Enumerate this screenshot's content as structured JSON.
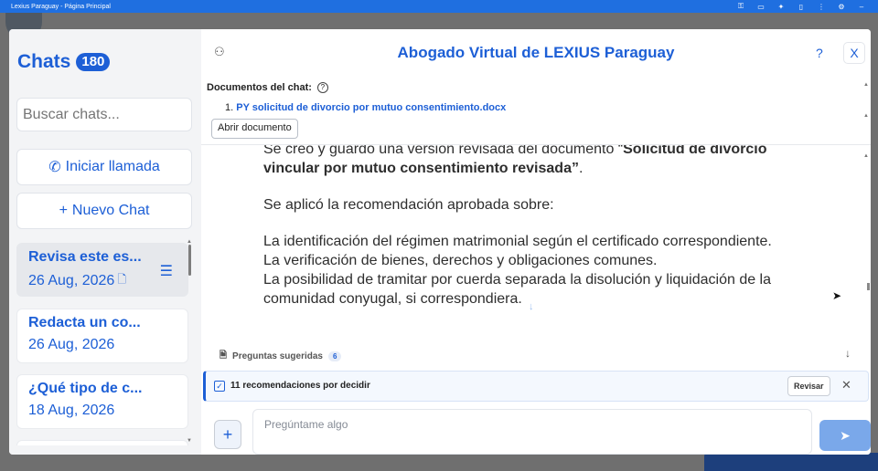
{
  "window": {
    "title": "Lexius Paraguay - Página Principal",
    "icons": [
      "key-icon",
      "tab-icon",
      "extension-icon",
      "panel-icon",
      "more-icon",
      "settings-icon",
      "minimize-icon"
    ]
  },
  "left": {
    "title": "Chats",
    "count": "180",
    "search_placeholder": "Buscar chats...",
    "call_label": "Iniciar llamada",
    "new_chat_label": "Nuevo Chat",
    "chats": [
      {
        "title": "Revisa este es...",
        "date": "26 Aug, 2026"
      },
      {
        "title": "Redacta un co...",
        "date": "26 Aug, 2026"
      },
      {
        "title": "¿Qué tipo de c...",
        "date": "18 Aug, 2026"
      }
    ]
  },
  "right": {
    "title": "Abogado Virtual de LEXIUS Paraguay",
    "help": "?",
    "close": "X",
    "docs_label": "Documentos del chat:",
    "doc_number": "1.",
    "doc_name": "PY solicitud de divorcio por mutuo consentimiento.docx",
    "open_doc": "Abrir documento",
    "message": {
      "line1": "Se creó y guardó una versión revisada del documento “",
      "line1_bold": "Solicitud de divorcio vincular por mutuo consentimiento revisada”",
      "line1_end": ".",
      "line2": "Se aplicó la recomendación aprobada sobre:",
      "bullets": [
        "La identificación del régimen matrimonial según el certificado correspondiente.",
        "La verificación de bienes, derechos y obligaciones comunes.",
        "La posibilidad de tramitar por cuerda separada la disolución y liquidación de la comunidad conyugal, si correspondiera."
      ]
    },
    "suggested_label": "Preguntas sugeridas",
    "suggested_count": "6",
    "reco_text": "11 recomendaciones por decidir",
    "reco_review": "Revisar",
    "input_placeholder": "Pregúntame algo"
  },
  "colors": {
    "accent": "#1d5fd6",
    "titlebar": "#1f6fe0",
    "send": "#7aa8ea"
  }
}
